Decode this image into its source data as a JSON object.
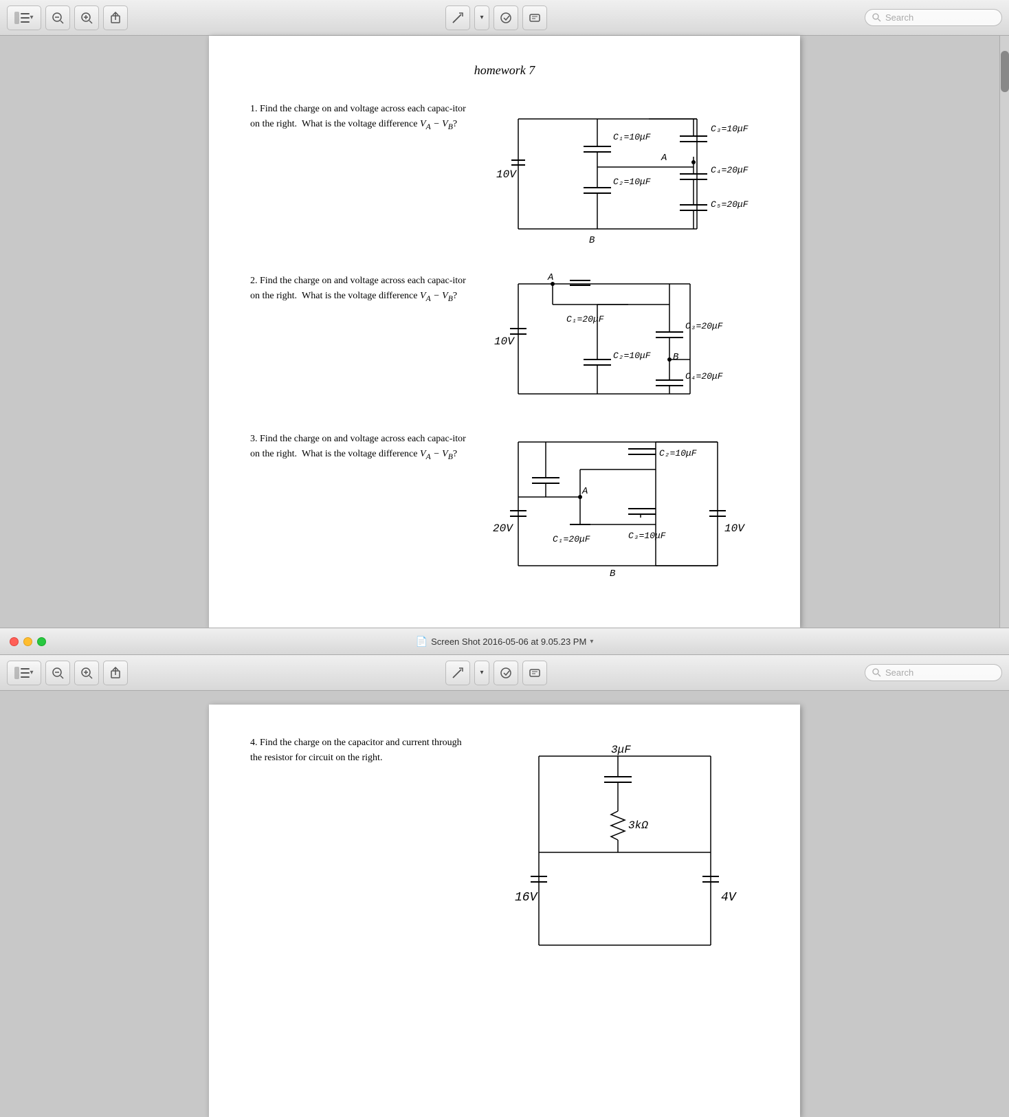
{
  "top_window": {
    "title": "Screen Shot 2016-05-06 at 9.05.23 PM",
    "toolbar": {
      "search_placeholder": "Search",
      "annotate_label": "Annotate",
      "share_label": "Share",
      "zoom_in_label": "Zoom In",
      "zoom_out_label": "Zoom Out",
      "sidebar_label": "Sidebar"
    },
    "page": {
      "title": "homework 7",
      "problems": [
        {
          "number": "1.",
          "text": "Find the charge on and voltage across each capacitor on the right.  What is the voltage difference V_A − V_B?"
        },
        {
          "number": "2.",
          "text": "Find the charge on and voltage across each capacitor on the right.  What is the voltage difference V_A − V_B?"
        },
        {
          "number": "3.",
          "text": "Find the charge on and voltage across each capacitor on the right.  What is the voltage difference V_A − V_B?"
        }
      ]
    }
  },
  "bottom_window": {
    "title": "Screen Shot 2016-05-06 at 9.05.23 PM",
    "toolbar": {
      "search_placeholder": "Search"
    },
    "page": {
      "problems": [
        {
          "number": "4.",
          "text": "Find the charge on the capacitor and current through the resistor for circuit on the right."
        }
      ]
    }
  }
}
